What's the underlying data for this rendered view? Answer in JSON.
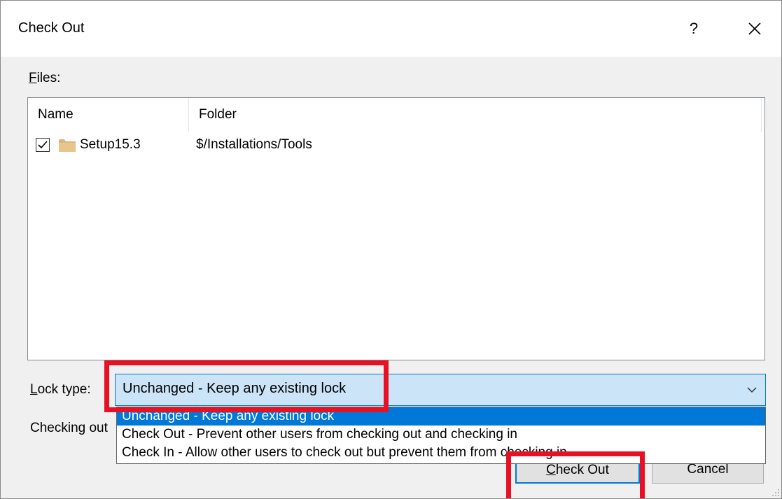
{
  "window": {
    "title": "Check Out",
    "help_label": "?",
    "close_icon": "close-icon"
  },
  "files": {
    "label_accel": "F",
    "label_rest": "iles:",
    "columns": [
      "Name",
      "Folder"
    ],
    "rows": [
      {
        "checked": true,
        "icon": "folder-icon",
        "name": "Setup15.3",
        "folder": "$/Installations/Tools"
      }
    ]
  },
  "lock": {
    "label_accel": "L",
    "label_rest": "ock type:",
    "selected": "Unchanged - Keep any existing lock",
    "options": [
      "Unchanged - Keep any existing lock",
      "Check Out - Prevent other users from checking out and checking in",
      "Check In - Allow other users to check out but prevent them from checking in"
    ]
  },
  "checking_label": "Checking out",
  "buttons": {
    "checkout_accel": "C",
    "checkout_rest": "heck Out",
    "cancel": "Cancel"
  },
  "colors": {
    "accent": "#0078d7",
    "annotation_red": "#e81123",
    "folder": "#dcb67a"
  }
}
